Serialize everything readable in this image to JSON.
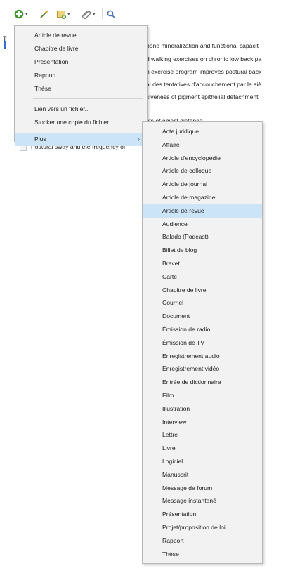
{
  "toolbar": {
    "icons": [
      "new-item-icon",
      "magic-wand-icon",
      "note-icon",
      "attachment-icon",
      "search-icon"
    ],
    "colors": {
      "green": "#3f9b2f",
      "gold": "#d6a43a"
    }
  },
  "left_header_letter": "T",
  "list_rows": [
    "bone mineralization and functional capacit",
    "d walking exercises on chronic low back pa",
    "n exercise program improves postural back",
    "al des tentatives d'accouchement par le siè",
    "siveness of pigment epithelial detachment",
    "cts of object distance",
    "Postural sway and the frequency of"
  ],
  "new_item_menu": {
    "items": [
      "Article de revue",
      "Chapitre de livre",
      "Présentation",
      "Rapport",
      "Thèse"
    ],
    "link_items": [
      "Lien vers un fichier...",
      "Stocker une copie du fichier..."
    ],
    "more_label": "Plus",
    "more_arrow": "›"
  },
  "more_submenu": {
    "items": [
      "Acte juridique",
      "Affaire",
      "Article d'encyclopédie",
      "Article de colloque",
      "Article de journal",
      "Article de magazine",
      "Article de revue",
      "Audience",
      "Balado (Podcast)",
      "Billet de blog",
      "Brevet",
      "Carte",
      "Chapitre de livre",
      "Courriel",
      "Document",
      "Émission de radio",
      "Émission de TV",
      "Enregistrement audio",
      "Enregistrement vidéo",
      "Entrée de dictionnaire",
      "Film",
      "Illustration",
      "Interview",
      "Lettre",
      "Livre",
      "Logiciel",
      "Manuscrit",
      "Message de forum",
      "Message instantané",
      "Présentation",
      "Projet/proposition de loi",
      "Rapport",
      "Thèse"
    ],
    "highlighted_index": 6,
    "highlight_color": "#cce4f7"
  }
}
